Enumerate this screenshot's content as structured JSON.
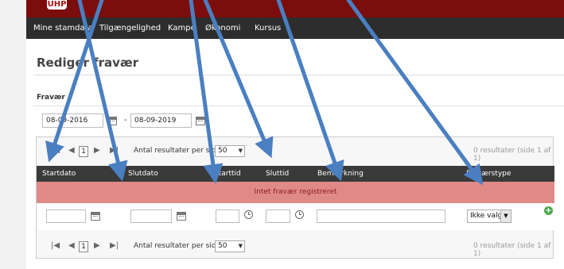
{
  "brand": {
    "logo_text": "UHP"
  },
  "nav": {
    "items": [
      "Mine stamdata",
      "Tilgængelighed",
      "Kampe",
      "Økonomi",
      "Kursus"
    ]
  },
  "page": {
    "title": "Rediger fravær"
  },
  "filter": {
    "section_label": "Fravær",
    "from_date": "08-09-2016",
    "separator": "-",
    "to_date": "08-09-2019"
  },
  "pager_top": {
    "page": "1",
    "per_page_label": "Antal resultater per side",
    "per_page_value": "50",
    "status": "0 resultater (side 1 af 1)"
  },
  "pager_bottom": {
    "page": "1",
    "per_page_label": "Antal resultater per side",
    "per_page_value": "50",
    "status": "0 resultater (side 1 af 1)"
  },
  "table": {
    "columns": [
      "Startdato",
      "Slutdato",
      "Starttid",
      "Sluttid",
      "Bemærkning",
      "Fraværstype"
    ],
    "empty_message": "Intet fravær registreret"
  },
  "new_row": {
    "type_select_value": "Ikke valgt"
  },
  "icons": {
    "calendar": "calendar-icon",
    "clock": "clock-icon",
    "add": "add-icon",
    "dropdown": "chevron-down-icon"
  },
  "colors": {
    "brand_bar": "#7c0d0d",
    "nav_bar": "#2d2d2d",
    "header_row": "#3a3a3a",
    "empty_row": "#e08a88",
    "annotation_arrow": "#4a7fc1"
  }
}
